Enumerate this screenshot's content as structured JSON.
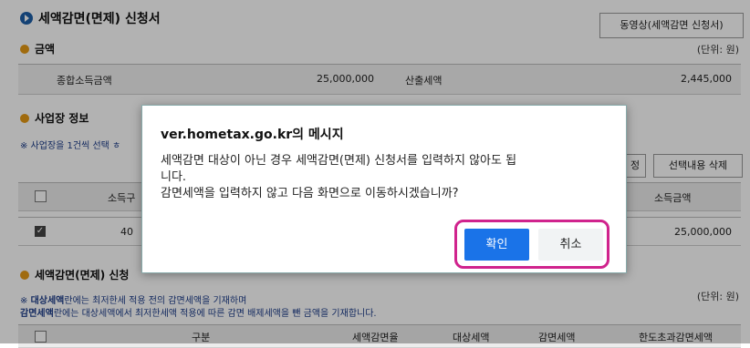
{
  "page": {
    "title": "세액감면(면제) 신청서",
    "video_button": "동영상(세액감면 신청서)",
    "amount_section": {
      "label": "금액",
      "unit": "(단위: 원)",
      "rows": [
        {
          "label": "종합소득금액",
          "value": "25,000,000"
        },
        {
          "label": "산출세액",
          "value": "2,445,000"
        }
      ]
    },
    "business_section": {
      "label": "사업장 정보",
      "note_visible": "※ 사업장을 1건씩 선택 ㅎ",
      "edit_button_fragment": "정",
      "delete_button": "선택내용 삭제",
      "col_income_fragment": "소득구",
      "col_income_amount": "소득금액",
      "row_value_fragment": "40",
      "row_income_amount": "25,000,000"
    },
    "reduction_section": {
      "label_fragment": "세액감면(면제) 신청",
      "unit": "(단위: 원)",
      "note_line1_bold": "대상세액",
      "note_line1_rest": "란에는 최저한세 적용 전의 감면세액을 기재하며",
      "note_line2_bold": "감면세액",
      "note_line2_rest": "란에는 대상세액에서 최저한세액 적용에 따른 감면 배제세액을 뺀 금액을 기재합니다.",
      "headers": [
        "구분",
        "세액감면율",
        "대상세액",
        "감면세액",
        "한도초과감면세액"
      ]
    }
  },
  "dialog": {
    "title": "ver.hometax.go.kr의 메시지",
    "message_line1": "세액감면 대상이 아닌 경우 세액감면(면제) 신청서를 입력하지 않아도 됩",
    "message_line2": "니다.",
    "message_line3": "감면세액을 입력하지 않고 다음 화면으로 이동하시겠습니까?",
    "ok_label": "확인",
    "cancel_label": "취소"
  },
  "colors": {
    "primary_button": "#1a73e8",
    "highlight": "#d0238d",
    "section_bullet": "#e59a15",
    "title_icon": "#1d5fa8"
  }
}
